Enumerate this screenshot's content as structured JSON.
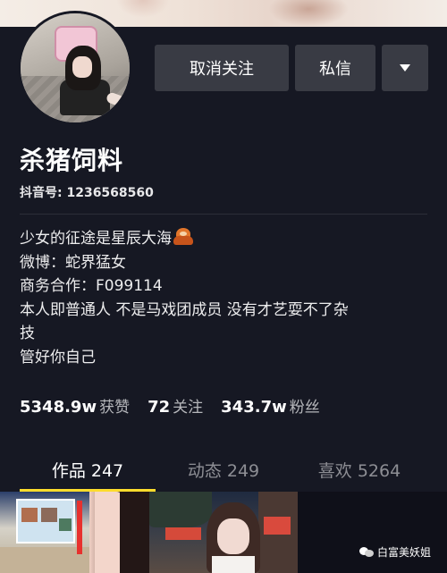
{
  "profile": {
    "name": "杀猪饲料",
    "douyin_id": "抖音号: 1236568560"
  },
  "actions": {
    "unfollow_label": "取消关注",
    "message_label": "私信",
    "more_icon": "caret-down-icon"
  },
  "bio": {
    "lines": [
      "少女的征途是星辰大海",
      "微博：蛇界猛女",
      "商务合作：F099114",
      "本人即普通人 不是马戏团成员 没有才艺耍不了杂",
      "技",
      "管好你自己"
    ],
    "emoji": "orangutan-emoji"
  },
  "stats": [
    {
      "value": "5348.9w",
      "label": "获赞"
    },
    {
      "value": "72",
      "label": "关注"
    },
    {
      "value": "343.7w",
      "label": "粉丝"
    }
  ],
  "tabs": [
    {
      "label": "作品 247",
      "active": true
    },
    {
      "label": "动态 249",
      "active": false
    },
    {
      "label": "喜欢 5264",
      "active": false
    }
  ],
  "watermark": {
    "text": "白富美妖姐",
    "icon": "wechat-icon"
  },
  "colors": {
    "background": "#161823",
    "button": "#393b44",
    "tab_active_underline": "#fddc2c",
    "muted_text": "#8d8e94"
  }
}
